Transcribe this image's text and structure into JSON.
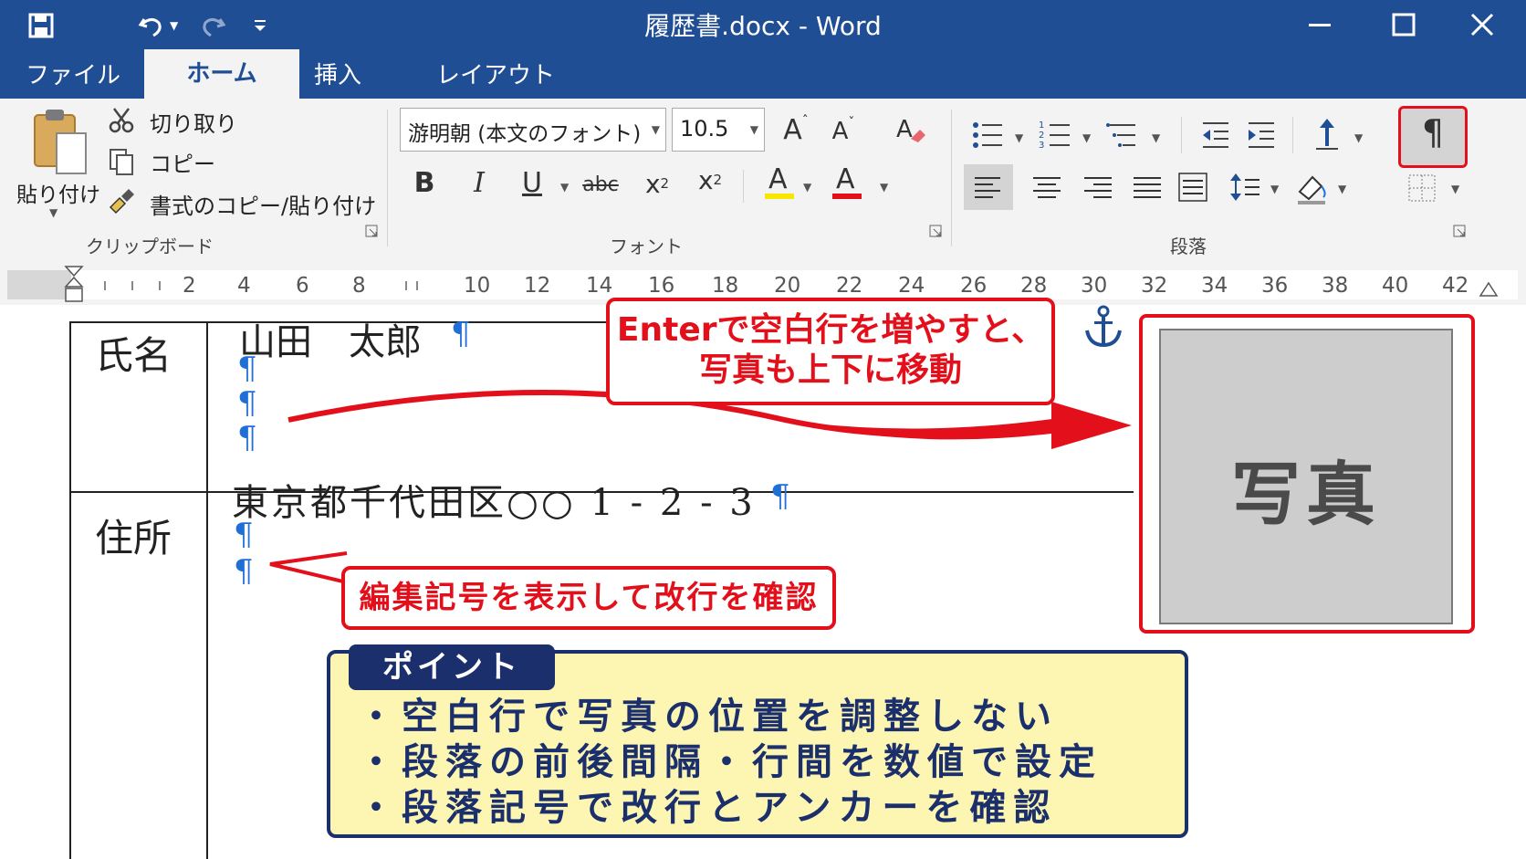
{
  "window": {
    "title": "履歴書.docx - Word"
  },
  "qat": {
    "save_icon": "save-icon",
    "undo_icon": "undo-icon",
    "redo_icon": "redo-icon",
    "customize_icon": "customize-icon"
  },
  "tabs": [
    {
      "label": "ファイル"
    },
    {
      "label": "ホーム"
    },
    {
      "label": "挿入"
    },
    {
      "label": "レイアウト"
    }
  ],
  "clipboard": {
    "paste": "貼り付け",
    "cut": "切り取り",
    "copy": "コピー",
    "format_painter": "書式のコピー/貼り付け",
    "group": "クリップボード"
  },
  "font": {
    "name": "游明朝 (本文のフォント)",
    "size": "10.5",
    "group": "フォント",
    "strike_label": "abc"
  },
  "paragraph": {
    "group": "段落",
    "show_marks_glyph": "¶"
  },
  "ruler": {
    "ticks": [
      "2",
      "4",
      "6",
      "8",
      "10",
      "12",
      "14",
      "16",
      "18",
      "20",
      "22",
      "24",
      "26",
      "28",
      "30",
      "32",
      "34",
      "36",
      "38",
      "40",
      "42"
    ]
  },
  "document": {
    "row1_label": "氏名",
    "name_value": "山田　太郎",
    "row2_label": "住所",
    "address_value": "東京都千代田区○○ 1 - 2 - 3",
    "mark": "¶",
    "photo_label": "写真"
  },
  "callouts": {
    "enter_line1": "Enterで空白行を増やすと、",
    "enter_line2": "写真も上下に移動",
    "marks": "編集記号を表示して改行を確認"
  },
  "point": {
    "title": "ポイント",
    "items": [
      "・空白行で写真の位置を調整しない",
      "・段落の前後間隔・行間を数値で設定",
      "・段落記号で改行とアンカーを確認"
    ]
  },
  "colors": {
    "title_bar": "#1f4e95",
    "accent_red": "#e3101b",
    "mark_blue": "#1f6fd6",
    "point_bg": "#fdf6b2",
    "point_border": "#1a2f6b"
  }
}
